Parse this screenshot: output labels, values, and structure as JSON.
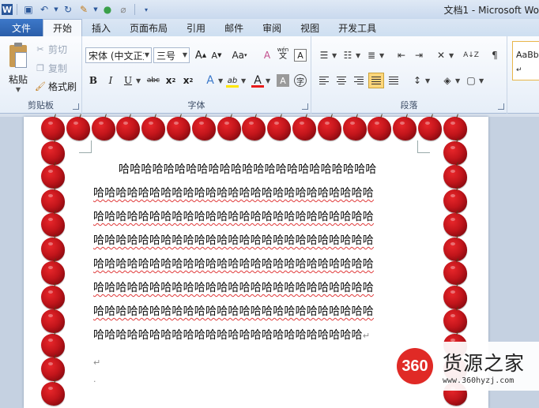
{
  "window": {
    "title": "文档1 - Microsoft Wo"
  },
  "tabs": [
    {
      "label": "文件"
    },
    {
      "label": "开始"
    },
    {
      "label": "插入"
    },
    {
      "label": "页面布局"
    },
    {
      "label": "引用"
    },
    {
      "label": "邮件"
    },
    {
      "label": "审阅"
    },
    {
      "label": "视图"
    },
    {
      "label": "开发工具"
    }
  ],
  "clipboard": {
    "paste": "粘贴",
    "cut": "剪切",
    "copy": "复制",
    "format_painter": "格式刷",
    "group_label": "剪贴板"
  },
  "font": {
    "family": "宋体 (中文正文)",
    "size": "三号",
    "grow": "A",
    "shrink": "A",
    "change_case": "Aa",
    "clear_format": "A",
    "phonetic": "wén",
    "enclose": "字",
    "border_char": "A",
    "bold": "B",
    "italic": "I",
    "underline": "U",
    "strike": "abc",
    "subscript": "x",
    "superscript": "x",
    "text_effect": "A",
    "highlight": "ab",
    "font_color": "A",
    "shading": "A",
    "circle": "字",
    "group_label": "字体",
    "highlight_color": "#ffe600",
    "font_color_value": "#e81c1c"
  },
  "paragraph": {
    "group_label": "段落",
    "sort": "A↓Z"
  },
  "styles": {
    "preview": "AaBb"
  },
  "document": {
    "lines": [
      "哈哈哈哈哈哈哈哈哈哈哈哈哈哈哈哈哈哈哈哈哈哈哈",
      "哈哈哈哈哈哈哈哈哈哈哈哈哈哈哈哈哈哈哈哈哈哈哈哈哈",
      "哈哈哈哈哈哈哈哈哈哈哈哈哈哈哈哈哈哈哈哈哈哈哈哈哈",
      "哈哈哈哈哈哈哈哈哈哈哈哈哈哈哈哈哈哈哈哈哈哈哈哈哈",
      "哈哈哈哈哈哈哈哈哈哈哈哈哈哈哈哈哈哈哈哈哈哈哈哈哈",
      "哈哈哈哈哈哈哈哈哈哈哈哈哈哈哈哈哈哈哈哈哈哈哈哈哈",
      "哈哈哈哈哈哈哈哈哈哈哈哈哈哈哈哈哈哈哈哈哈哈哈哈哈",
      "哈哈哈哈哈哈哈哈哈哈哈哈哈哈哈哈哈哈哈哈哈哈哈哈"
    ],
    "paragraph_mark": "↵",
    "empty_mark": "↵",
    "dot_mark": "·"
  },
  "watermark": {
    "logo": "360",
    "name": "货源之家",
    "url": "www.360hyzj.com"
  }
}
